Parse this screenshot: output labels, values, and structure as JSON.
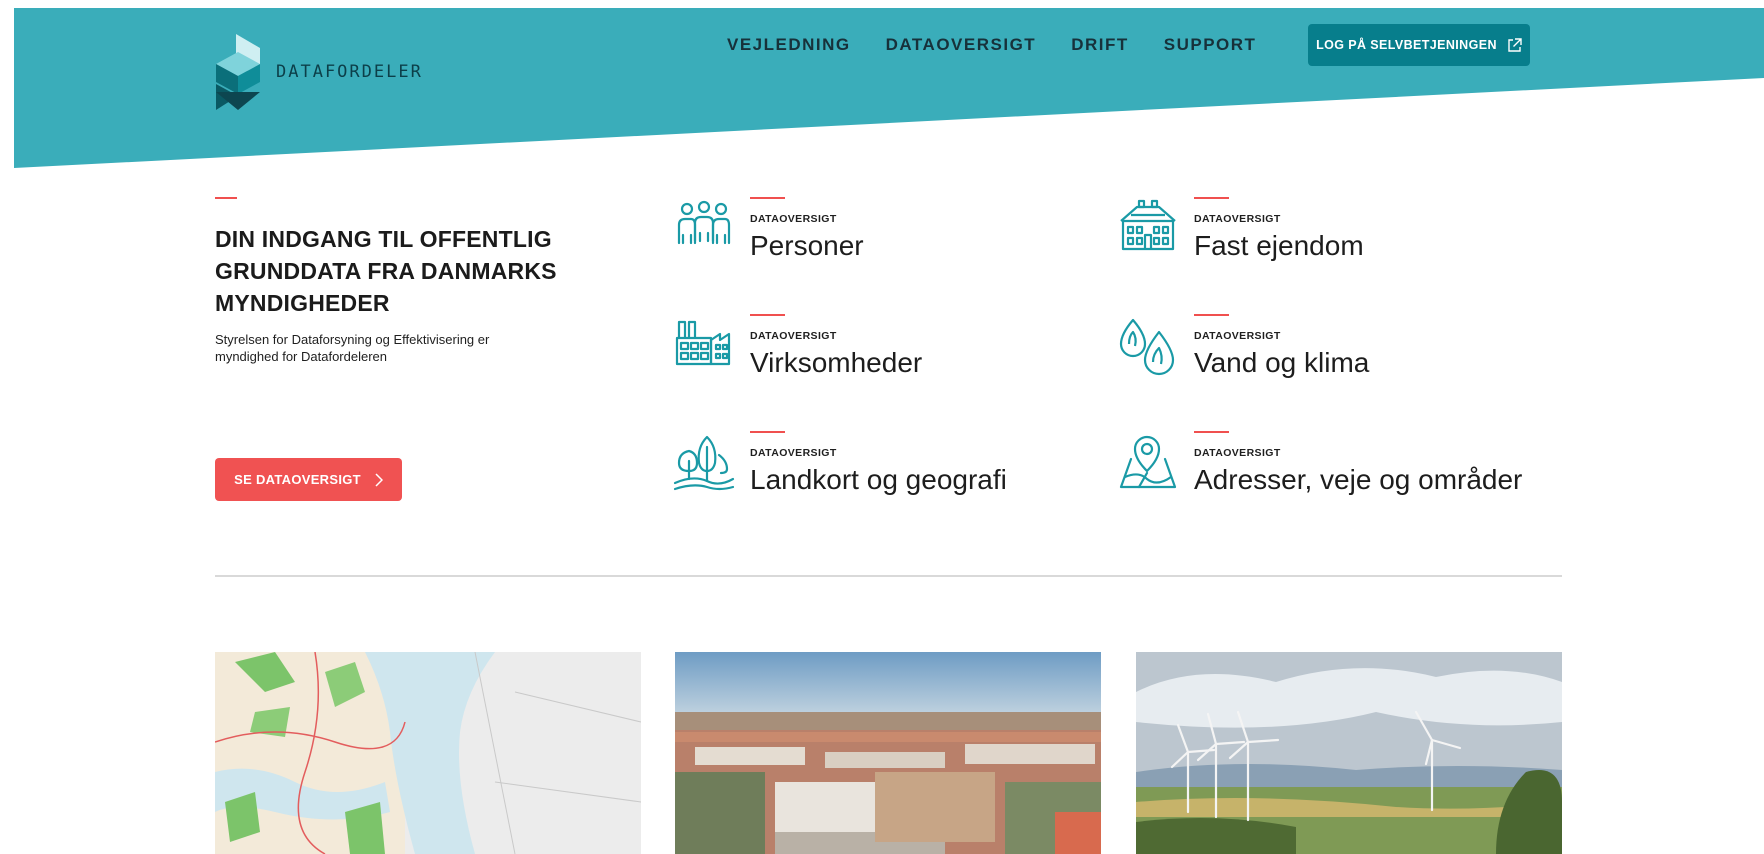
{
  "brand": {
    "name": "DATAFORDELER"
  },
  "nav": {
    "items": [
      "VEJLEDNING",
      "DATAOVERSIGT",
      "DRIFT",
      "SUPPORT"
    ],
    "login_label": "LOG PÅ SELVBETJENINGEN"
  },
  "hero": {
    "heading": "DIN INDGANG TIL OFFENTLIG GRUNDDATA FRA DANMARKS MYNDIGHEDER",
    "description": "Styrelsen for Dataforsyning og Effektivisering er myndighed for Datafordeleren",
    "cta_label": "SE DATAOVERSIGT"
  },
  "categories": [
    {
      "kicker": "DATAOVERSIGT",
      "title": "Personer",
      "icon": "people-icon"
    },
    {
      "kicker": "DATAOVERSIGT",
      "title": "Fast ejendom",
      "icon": "building-icon"
    },
    {
      "kicker": "DATAOVERSIGT",
      "title": "Virksomheder",
      "icon": "factory-icon"
    },
    {
      "kicker": "DATAOVERSIGT",
      "title": "Vand og klima",
      "icon": "water-drops-icon"
    },
    {
      "kicker": "DATAOVERSIGT",
      "title": "Landkort og geografi",
      "icon": "trees-landscape-icon"
    },
    {
      "kicker": "DATAOVERSIGT",
      "title": "Adresser, veje og områder",
      "icon": "map-pin-icon"
    }
  ],
  "cards": [
    {
      "image": "map-image"
    },
    {
      "image": "city-image"
    },
    {
      "image": "wind-turbines-image"
    }
  ],
  "colors": {
    "header_teal": "#3aadba",
    "button_teal": "#077e8c",
    "accent_red": "#f05252",
    "icon_teal": "#1a9aa6"
  }
}
